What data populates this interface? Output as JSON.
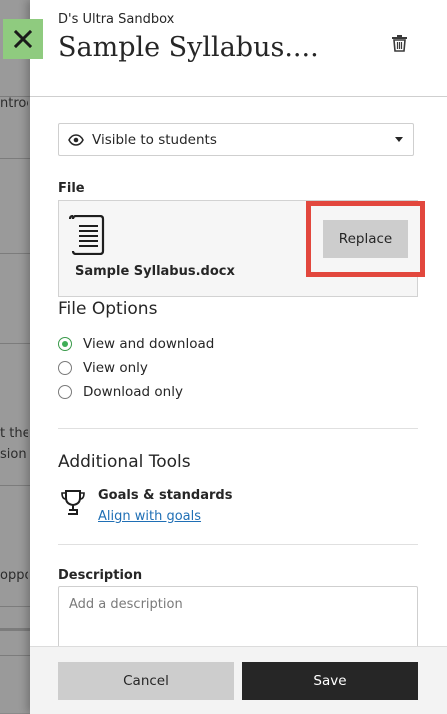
{
  "background": {
    "snippets": [
      "ntroc",
      "t the",
      "sion",
      "oppo"
    ]
  },
  "header": {
    "course_name": "D's Ultra Sandbox",
    "title": "Sample Syllabus...."
  },
  "visibility": {
    "selected": "Visible to students"
  },
  "file": {
    "heading": "File",
    "name": "Sample Syllabus.docx",
    "replace_label": "Replace"
  },
  "file_options": {
    "heading": "File Options",
    "options": [
      {
        "label": "View and download",
        "checked": true
      },
      {
        "label": "View only",
        "checked": false
      },
      {
        "label": "Download only",
        "checked": false
      }
    ]
  },
  "additional_tools": {
    "heading": "Additional Tools",
    "goals_title": "Goals & standards",
    "goals_link": "Align with goals"
  },
  "description": {
    "heading": "Description",
    "placeholder": "Add a description",
    "value": ""
  },
  "footer": {
    "cancel_label": "Cancel",
    "save_label": "Save"
  },
  "colors": {
    "close_bg": "#8fcb7f",
    "highlight": "#e2473d",
    "radio_checked": "#3fae57",
    "link": "#1f6fb5",
    "save_bg": "#262626"
  }
}
